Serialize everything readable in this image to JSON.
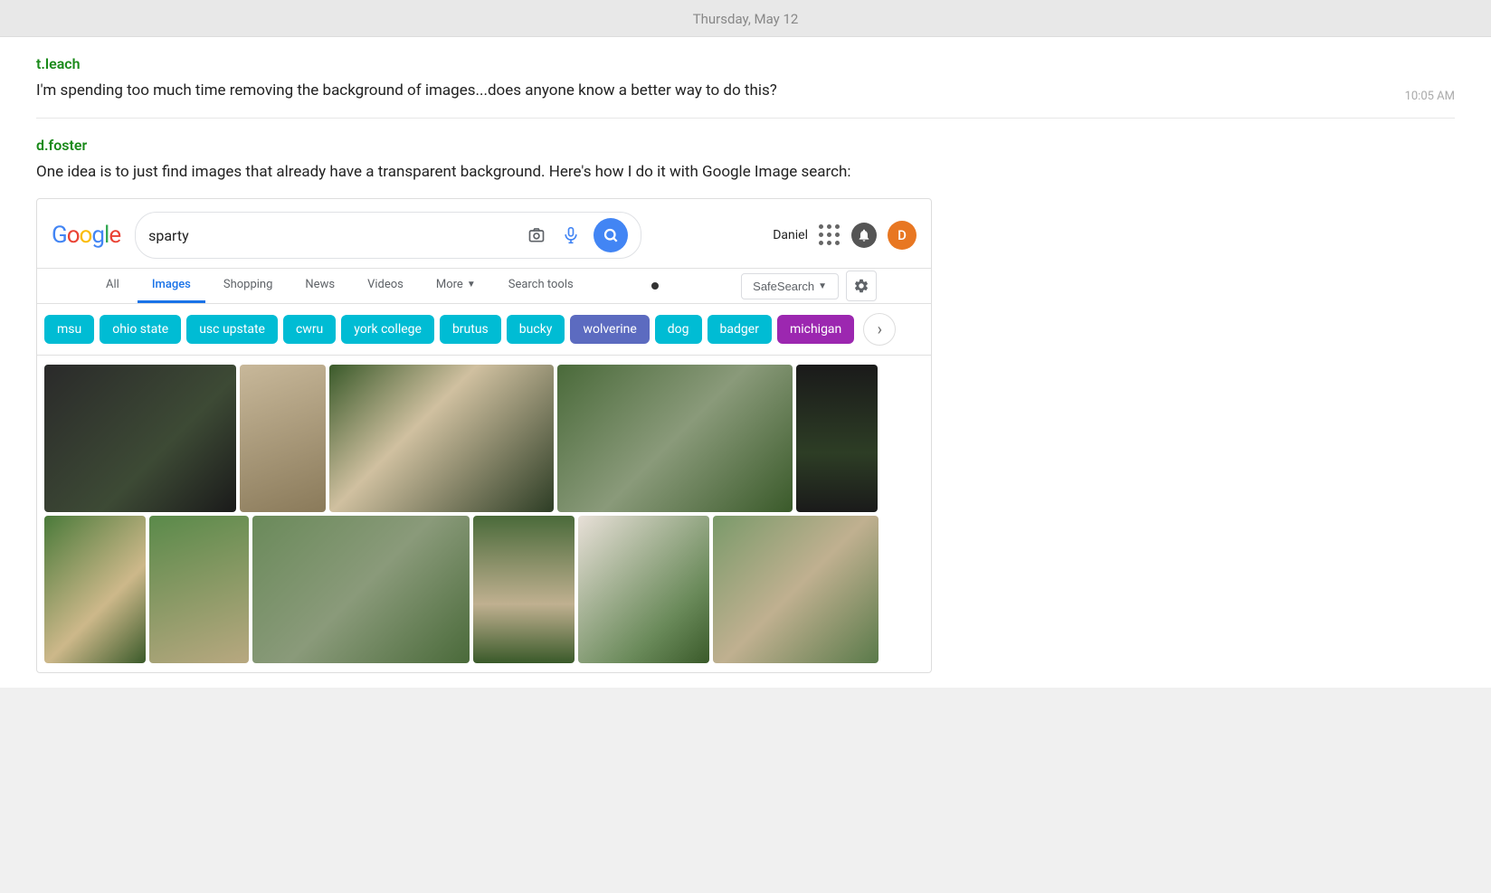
{
  "page": {
    "date": "Thursday, May 12",
    "messages": [
      {
        "id": "msg1",
        "username": "t.leach",
        "text": "I'm spending too much time removing the background of images...does anyone know a better way to do this?",
        "timestamp": "10:05 AM"
      },
      {
        "id": "msg2",
        "username": "d.foster",
        "text": "One idea is to just find images that already have a transparent background. Here's how I do it with Google Image search:"
      }
    ]
  },
  "google": {
    "logo": "Google",
    "search_query": "sparty",
    "user_name": "Daniel",
    "avatar_letter": "D",
    "tabs": [
      {
        "label": "All",
        "active": false
      },
      {
        "label": "Images",
        "active": true
      },
      {
        "label": "Shopping",
        "active": false
      },
      {
        "label": "News",
        "active": false
      },
      {
        "label": "Videos",
        "active": false
      },
      {
        "label": "More",
        "active": false
      },
      {
        "label": "Search tools",
        "active": false
      }
    ],
    "safe_search_label": "SafeSearch",
    "chips": [
      {
        "label": "msu",
        "color": "teal"
      },
      {
        "label": "ohio state",
        "color": "teal"
      },
      {
        "label": "usc upstate",
        "color": "teal"
      },
      {
        "label": "cwru",
        "color": "teal"
      },
      {
        "label": "york college",
        "color": "teal"
      },
      {
        "label": "brutus",
        "color": "teal"
      },
      {
        "label": "bucky",
        "color": "teal"
      },
      {
        "label": "wolverine",
        "color": "blue"
      },
      {
        "label": "dog",
        "color": "teal"
      },
      {
        "label": "badger",
        "color": "teal"
      },
      {
        "label": "michigan",
        "color": "purple"
      }
    ]
  }
}
